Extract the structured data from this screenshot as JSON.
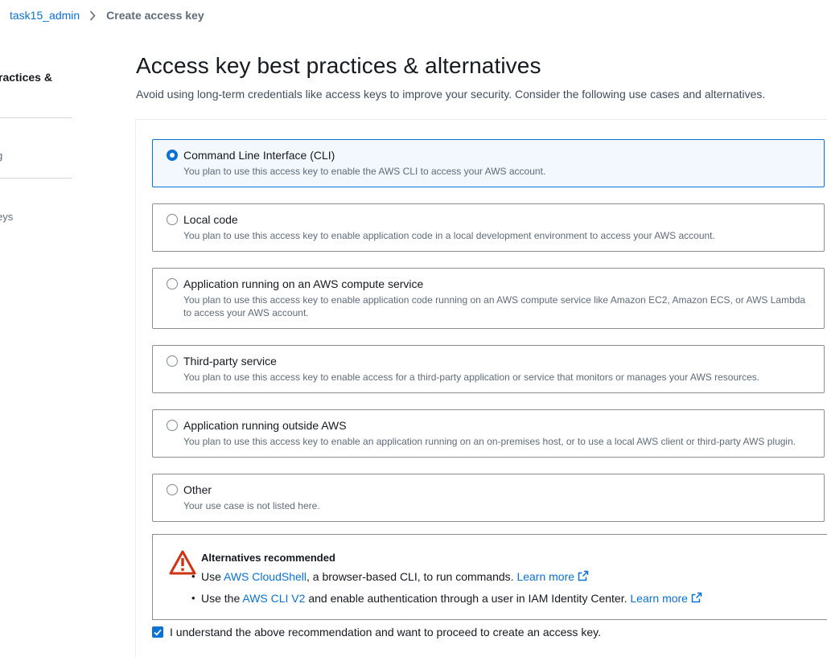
{
  "breadcrumb": {
    "parent": "task15_admin",
    "current": "Create access key"
  },
  "steps": [
    {
      "label": "ractices &"
    },
    {
      "label": "g"
    },
    {
      "label": "eys"
    }
  ],
  "page": {
    "title": "Access key best practices & alternatives",
    "description": "Avoid using long-term credentials like access keys to improve your security. Consider the following use cases and alternatives."
  },
  "options": [
    {
      "title": "Command Line Interface (CLI)",
      "desc": "You plan to use this access key to enable the AWS CLI to access your AWS account.",
      "selected": true
    },
    {
      "title": "Local code",
      "desc": "You plan to use this access key to enable application code in a local development environment to access your AWS account.",
      "selected": false
    },
    {
      "title": "Application running on an AWS compute service",
      "desc": "You plan to use this access key to enable application code running on an AWS compute service like Amazon EC2, Amazon ECS, or AWS Lambda to access your AWS account.",
      "selected": false
    },
    {
      "title": "Third-party service",
      "desc": "You plan to use this access key to enable access for a third-party application or service that monitors or manages your AWS resources.",
      "selected": false
    },
    {
      "title": "Application running outside AWS",
      "desc": "You plan to use this access key to enable an application running on an on-premises host, or to use a local AWS client or third-party AWS plugin.",
      "selected": false
    },
    {
      "title": "Other",
      "desc": "Your use case is not listed here.",
      "selected": false
    }
  ],
  "alert": {
    "title": "Alternatives recommended",
    "item1": {
      "prefix": "Use ",
      "link": "AWS CloudShell",
      "suffix": ", a browser-based CLI, to run commands. ",
      "learn_more": "Learn more"
    },
    "item2": {
      "prefix": "Use the ",
      "link": "AWS CLI V2",
      "suffix": " and enable authentication through a user in IAM Identity Center. ",
      "learn_more": "Learn more"
    }
  },
  "acknowledge": {
    "label": "I understand the above recommendation and want to proceed to create an access key.",
    "checked": true
  },
  "colors": {
    "accent": "#0972d3",
    "selected_bg": "#f2f8fd",
    "warning": "#d13212"
  }
}
